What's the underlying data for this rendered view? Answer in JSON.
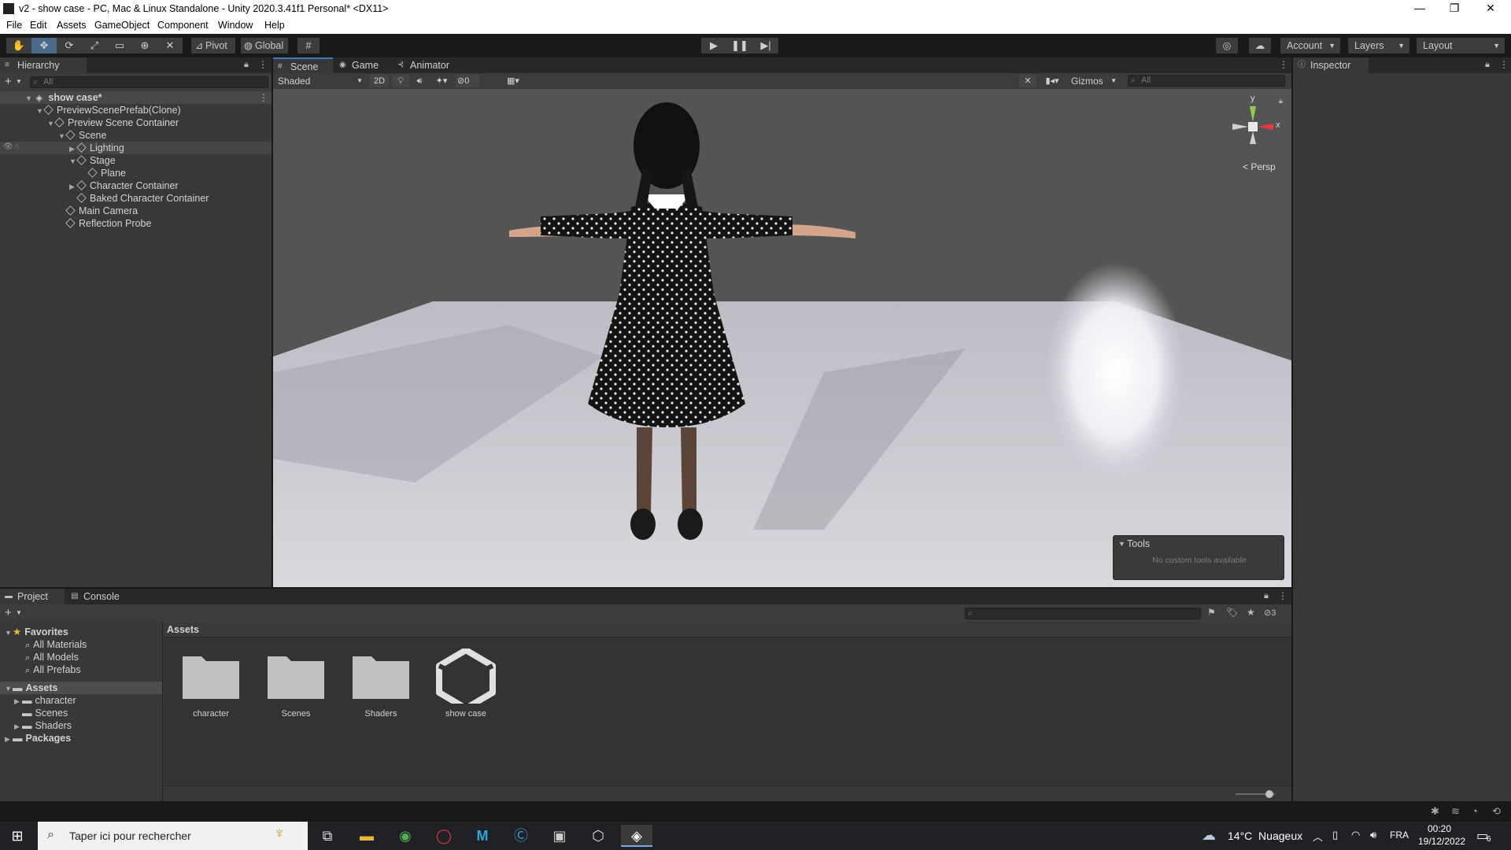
{
  "window": {
    "title": "v2 - show case - PC, Mac & Linux Standalone - Unity 2020.3.41f1 Personal* <DX11>",
    "minimize_glyph": "—",
    "restore_glyph": "❐",
    "close_glyph": "✕"
  },
  "menu": [
    "File",
    "Edit",
    "Assets",
    "GameObject",
    "Component",
    "Window",
    "Help"
  ],
  "toolbar": {
    "pivot_label": "Pivot",
    "global_label": "Global",
    "account_label": "Account",
    "layers_label": "Layers",
    "layout_label": "Layout"
  },
  "hierarchy": {
    "tab_label": "Hierarchy",
    "search_placeholder": "All",
    "scene_name": "show case*",
    "items": [
      {
        "label": "PreviewScenePrefab(Clone)"
      },
      {
        "label": "Preview Scene Container"
      },
      {
        "label": "Scene"
      },
      {
        "label": "Lighting"
      },
      {
        "label": "Stage"
      },
      {
        "label": "Plane"
      },
      {
        "label": "Character Container"
      },
      {
        "label": "Baked Character Container"
      },
      {
        "label": "Main Camera"
      },
      {
        "label": "Reflection Probe"
      }
    ]
  },
  "scene": {
    "tabs": [
      "Scene",
      "Game",
      "Animator"
    ],
    "shading_mode": "Shaded",
    "mode_2d": "2D",
    "hidden_count": "0",
    "gizmos_label": "Gizmos",
    "search_placeholder": "All",
    "persp_label": "< Persp",
    "axis_y": "y",
    "axis_x": "x",
    "tools_overlay_title": "Tools",
    "tools_overlay_message": "No custom tools available"
  },
  "inspector": {
    "tab_label": "Inspector"
  },
  "project": {
    "tabs": [
      "Project",
      "Console"
    ],
    "hidden_count": "3",
    "breadcrumb": "Assets",
    "favorites_label": "Favorites",
    "favorites": [
      "All Materials",
      "All Models",
      "All Prefabs"
    ],
    "assets_label": "Assets",
    "asset_folders": [
      "character",
      "Scenes",
      "Shaders"
    ],
    "packages_label": "Packages",
    "grid_items": [
      {
        "label": "character",
        "kind": "folder"
      },
      {
        "label": "Scenes",
        "kind": "folder"
      },
      {
        "label": "Shaders",
        "kind": "folder"
      },
      {
        "label": "show case",
        "kind": "unity-scene"
      }
    ],
    "icon_size_fraction": 0.85
  },
  "taskbar": {
    "search_placeholder": "Taper ici pour rechercher",
    "weather": "14°C  Nuageux",
    "language": "FRA",
    "time": "00:20",
    "date": "19/12/2022",
    "notification_count": "6"
  },
  "colors": {
    "editor_bg": "#383838",
    "toolbar_bg": "#191919",
    "accent_blue": "#2c5d87",
    "gizmo_y": "#8fd14a",
    "gizmo_x": "#e83a3a"
  }
}
